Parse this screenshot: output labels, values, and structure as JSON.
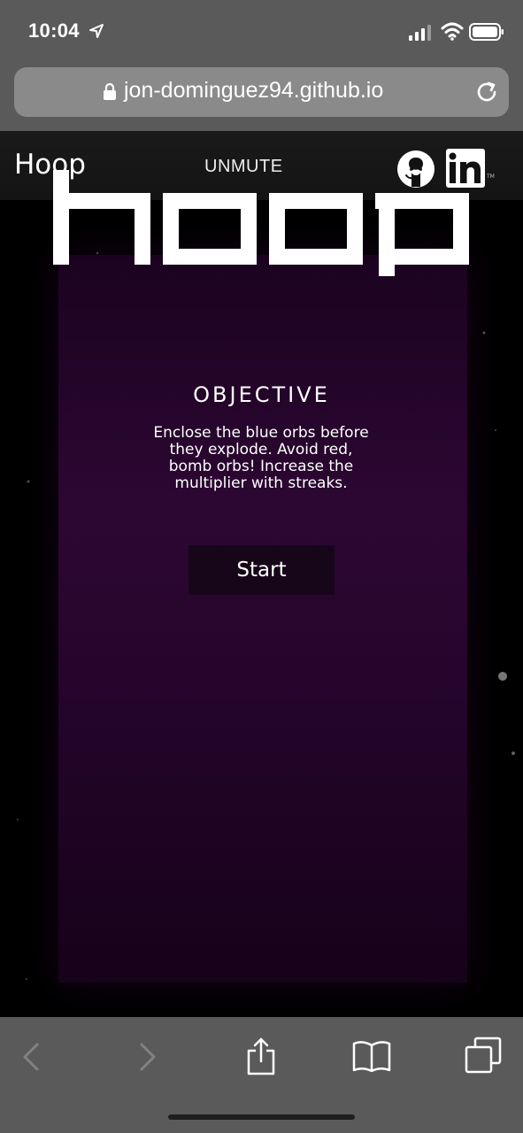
{
  "status_bar": {
    "time": "10:04",
    "icons": [
      "location-arrow-icon",
      "cellular-signal-icon",
      "wifi-icon",
      "battery-icon"
    ]
  },
  "browser": {
    "url": "jon-dominguez94.github.io",
    "icons": [
      "lock-icon",
      "reload-icon"
    ],
    "toolbar_icons": [
      "back-icon",
      "forward-icon",
      "share-icon",
      "bookmarks-icon",
      "tabs-icon"
    ]
  },
  "site": {
    "title": "Hoop",
    "unmute_label": "UNMUTE",
    "social_icons": [
      "github-icon",
      "linkedin-icon"
    ],
    "linkedin_tm": "TM"
  },
  "game": {
    "logo_text": "hoop",
    "objective_title": "OBJECTIVE",
    "objective_text": "Enclose the blue orbs before they explode. Avoid red, bomb orbs! Increase the multiplier with streaks.",
    "start_label": "Start"
  },
  "colors": {
    "browser_chrome": "#5a5a5a",
    "url_field": "#8a8a8a",
    "panel_purple": "#2c0732",
    "start_button": "#17061a"
  }
}
